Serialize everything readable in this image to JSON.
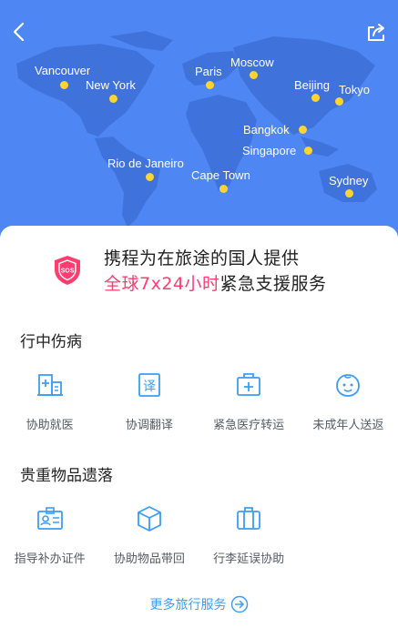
{
  "nav": {
    "back_icon": "back-arrow-icon",
    "share_icon": "share-icon"
  },
  "map": {
    "cities": [
      {
        "id": "vancouver",
        "name": "Vancouver"
      },
      {
        "id": "new-york",
        "name": "New York"
      },
      {
        "id": "paris",
        "name": "Paris"
      },
      {
        "id": "moscow",
        "name": "Moscow"
      },
      {
        "id": "beijing",
        "name": "Beijing"
      },
      {
        "id": "tokyo",
        "name": "Tokyo"
      },
      {
        "id": "bangkok",
        "name": "Bangkok"
      },
      {
        "id": "singapore",
        "name": "Singapore"
      },
      {
        "id": "rio-de-janeiro",
        "name": "Rio de Janeiro"
      },
      {
        "id": "cape-town",
        "name": "Cape Town"
      },
      {
        "id": "sydney",
        "name": "Sydney"
      }
    ],
    "colors": {
      "background": "#4e87f4",
      "land": "#3f73db",
      "dot": "#ffd330"
    }
  },
  "header": {
    "sos_icon": "sos-shield-icon",
    "sos_text": "SOS",
    "line1": "携程为在旅途的国人提供",
    "line2_highlight": "全球7x24小时",
    "line2_rest": "紧急支援服务",
    "highlight_color": "#ff3d6e"
  },
  "sections": [
    {
      "title": "行中伤病",
      "items": [
        {
          "label": "协助就医",
          "icon": "hospital-icon"
        },
        {
          "label": "协调翻译",
          "icon": "translate-icon"
        },
        {
          "label": "紧急医疗转运",
          "icon": "medical-kit-icon"
        },
        {
          "label": "未成年人送返",
          "icon": "child-face-icon"
        }
      ]
    },
    {
      "title": "贵重物品遗落",
      "items": [
        {
          "label": "指导补办证件",
          "icon": "id-card-icon"
        },
        {
          "label": "协助物品带回",
          "icon": "package-icon"
        },
        {
          "label": "行李延误协助",
          "icon": "luggage-icon"
        }
      ]
    }
  ],
  "footer": {
    "more_label": "更多旅行服务",
    "more_icon": "arrow-circle-right-icon",
    "link_color": "#3d9df5"
  }
}
